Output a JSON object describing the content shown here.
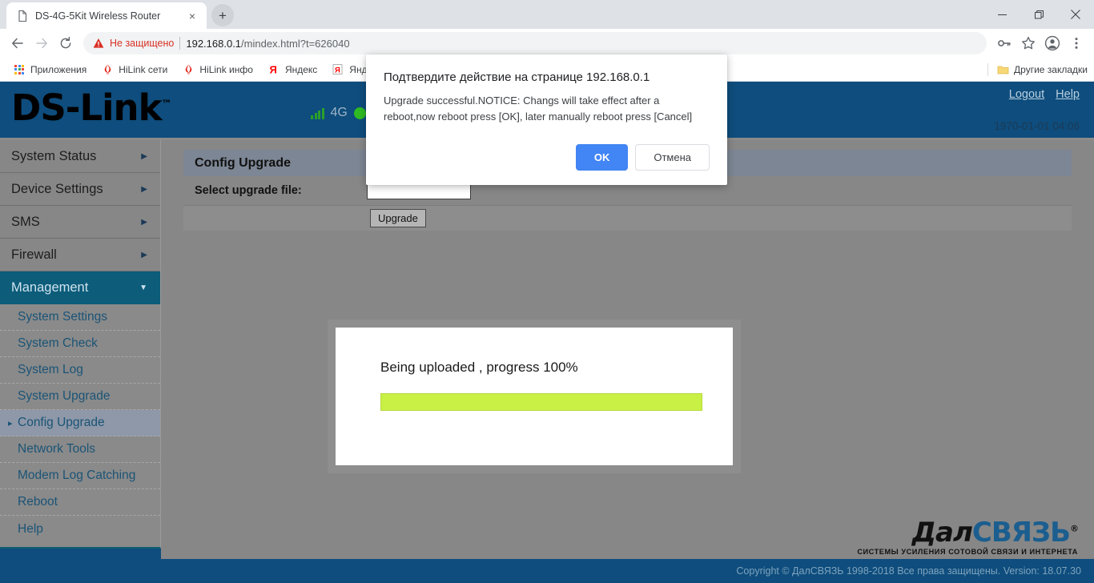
{
  "browser": {
    "tab": {
      "title": "DS-4G-5Kit Wireless Router",
      "favicon": "page-icon",
      "close": "×"
    },
    "new_tab_label": "+",
    "window_controls": {
      "minimize": "minimize-icon",
      "restore": "restore-icon",
      "close": "close-icon"
    },
    "nav": {
      "back": "back-arrow-icon",
      "forward": "forward-arrow-icon",
      "reload": "reload-icon"
    },
    "omnibox": {
      "security_label": "Не защищено",
      "url_host": "192.168.0.1",
      "url_path": "/mindex.html?t=626040"
    },
    "toolbar_icons": [
      "key-icon",
      "star-icon",
      "profile-icon",
      "menu-icon"
    ],
    "bookmarks": [
      {
        "label": "Приложения",
        "icon": "apps-grid-icon"
      },
      {
        "label": "HiLink сети",
        "icon": "huawei-icon"
      },
      {
        "label": "HiLink инфо",
        "icon": "huawei-icon"
      },
      {
        "label": "Яндекс",
        "icon": "yandex-icon"
      },
      {
        "label": "Янде",
        "icon": "yandex-box-icon"
      }
    ],
    "other_bookmarks": {
      "label": "Другие закладки",
      "icon": "folder-icon"
    }
  },
  "site": {
    "logo": {
      "text": "DS-Link",
      "tm": "™"
    },
    "status": {
      "signal": "signal-bars-icon",
      "network": "4G",
      "led": "status-led-icon"
    },
    "links": {
      "logout": "Logout",
      "help": "Help"
    },
    "datetime": "1970-01-01 04:06"
  },
  "sidebar": {
    "menu": [
      {
        "label": "System Status",
        "caret": "▶",
        "active": false
      },
      {
        "label": "Device Settings",
        "caret": "▶",
        "active": false
      },
      {
        "label": "SMS",
        "caret": "▶",
        "active": false
      },
      {
        "label": "Firewall",
        "caret": "▶",
        "active": false
      },
      {
        "label": "Management",
        "caret": "▼",
        "active": true
      }
    ],
    "submenu": [
      {
        "label": "System Settings",
        "selected": false
      },
      {
        "label": "System Check",
        "selected": false
      },
      {
        "label": "System Log",
        "selected": false
      },
      {
        "label": "System Upgrade",
        "selected": false
      },
      {
        "label": "Config Upgrade",
        "selected": true
      },
      {
        "label": "Network Tools",
        "selected": false
      },
      {
        "label": "Modem Log Catching",
        "selected": false
      },
      {
        "label": "Reboot",
        "selected": false
      },
      {
        "label": "Help",
        "selected": false
      }
    ]
  },
  "main": {
    "panel_title": "Config Upgrade",
    "file_label": "Select upgrade file:",
    "file_value": "",
    "upgrade_button": "Upgrade"
  },
  "progress": {
    "text": "Being uploaded , progress 100%",
    "percent": 100,
    "fill_color": "#c8f045"
  },
  "dialog": {
    "title": "Подтвердите действие на странице 192.168.0.1",
    "message": "Upgrade successful.NOTICE: Changs will take effect after a reboot,now reboot press [OK], later manually reboot press [Cancel]",
    "ok": "OK",
    "cancel": "Отмена",
    "ok_color": "#4285f4"
  },
  "footer": {
    "brand": {
      "part1": "Дал",
      "part2": "СВЯЗЬ",
      "reg": "®"
    },
    "tagline": "СИСТЕМЫ УСИЛЕНИЯ СОТОВОЙ СВЯЗИ И ИНТЕРНЕТА",
    "copyright": "Copyright © ДалСВЯЗЬ 1998-2018 Все права защищены. Version: 18.07.30"
  }
}
